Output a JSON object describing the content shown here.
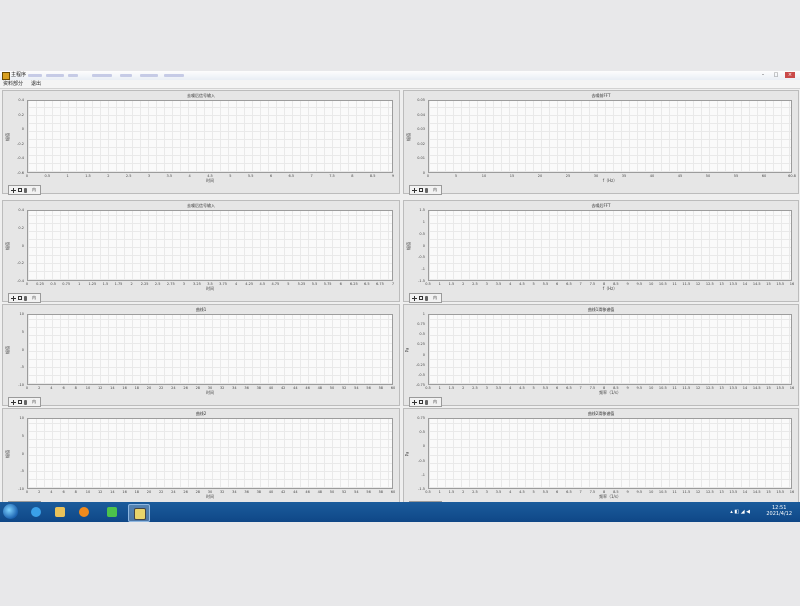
{
  "window": {
    "title": "主程序",
    "min": "–",
    "max": "□",
    "close": "×"
  },
  "menu": [
    "资料部分",
    "退出"
  ],
  "panels": [
    {
      "title": "去噪后信号输入",
      "ylabel": "幅值",
      "xlabel": "时间",
      "yticks": [
        "0.4",
        "0.2",
        "0",
        "-0.2",
        "-0.4",
        "-0.6"
      ],
      "xticks": [
        "0",
        "0.5",
        "1",
        "1.5",
        "2",
        "2.5",
        "3",
        "3.5",
        "4",
        "4.5",
        "5",
        "5.5",
        "6",
        "6.5",
        "7",
        "7.5",
        "8",
        "8.5",
        "9"
      ]
    },
    {
      "title": "去噪前FFT",
      "ylabel": "幅值",
      "xlabel": "f（Hz）",
      "yticks": [
        "0.05",
        "0.04",
        "0.03",
        "0.02",
        "0.01",
        "0"
      ],
      "xticks": [
        "0",
        "5",
        "10",
        "15",
        "20",
        "25",
        "30",
        "35",
        "40",
        "45",
        "50",
        "55",
        "60",
        "60.8"
      ]
    },
    {
      "title": "去噪后信号输入",
      "ylabel": "幅值",
      "xlabel": "时间",
      "yticks": [
        "0.4",
        "0.2",
        "0",
        "-0.2",
        "-0.4"
      ],
      "xticks": [
        "0",
        "0.25",
        "0.5",
        "0.75",
        "1",
        "1.25",
        "1.5",
        "1.75",
        "2",
        "2.25",
        "2.5",
        "2.75",
        "3",
        "3.25",
        "3.5",
        "3.75",
        "4",
        "4.25",
        "4.5",
        "4.75",
        "5",
        "5.25",
        "5.5",
        "5.75",
        "6",
        "6.25",
        "6.5",
        "6.75",
        "7"
      ]
    },
    {
      "title": "去噪后FFT",
      "ylabel": "幅值",
      "xlabel": "f（Hz）",
      "yticks": [
        "1.5",
        "1",
        "0.5",
        "0",
        "-0.5",
        "-1",
        "-1.5"
      ],
      "xticks": [
        "0.5",
        "1",
        "1.5",
        "2",
        "2.5",
        "3",
        "3.5",
        "4",
        "4.5",
        "5",
        "5.5",
        "6",
        "6.5",
        "7",
        "7.5",
        "8",
        "8.5",
        "9",
        "9.5",
        "10",
        "10.5",
        "11",
        "11.5",
        "12",
        "12.5",
        "13",
        "13.5",
        "14",
        "14.5",
        "15",
        "15.5",
        "16"
      ]
    },
    {
      "title": "曲线1",
      "ylabel": "幅值",
      "xlabel": "时间",
      "yticks": [
        "10",
        "5",
        "0",
        "-5",
        "-10"
      ],
      "xticks": [
        "0",
        "2",
        "4",
        "6",
        "8",
        "10",
        "12",
        "14",
        "16",
        "18",
        "20",
        "22",
        "24",
        "26",
        "28",
        "30",
        "32",
        "34",
        "36",
        "38",
        "40",
        "42",
        "44",
        "46",
        "48",
        "50",
        "52",
        "54",
        "56",
        "58",
        "60"
      ]
    },
    {
      "title": "曲线1滑移谱值",
      "ylabel": "Pa",
      "xlabel": "频率（1/s）",
      "yticks": [
        "1",
        "0.75",
        "0.5",
        "0.25",
        "0",
        "-0.25",
        "-0.5",
        "-0.75"
      ],
      "xticks": [
        "0.5",
        "1",
        "1.5",
        "2",
        "2.5",
        "3",
        "3.5",
        "4",
        "4.5",
        "5",
        "5.5",
        "6",
        "6.5",
        "7",
        "7.5",
        "8",
        "8.5",
        "9",
        "9.5",
        "10",
        "10.5",
        "11",
        "11.5",
        "12",
        "12.5",
        "13",
        "13.5",
        "14",
        "14.5",
        "15",
        "15.5",
        "16"
      ]
    },
    {
      "title": "曲线2",
      "ylabel": "幅值",
      "xlabel": "时间",
      "yticks": [
        "10",
        "5",
        "0",
        "-5",
        "-10"
      ],
      "xticks": [
        "0",
        "2",
        "4",
        "6",
        "8",
        "10",
        "12",
        "14",
        "16",
        "18",
        "20",
        "22",
        "24",
        "26",
        "28",
        "30",
        "32",
        "34",
        "36",
        "38",
        "40",
        "42",
        "44",
        "46",
        "48",
        "50",
        "52",
        "54",
        "56",
        "58",
        "60"
      ]
    },
    {
      "title": "曲线2滑移谱值",
      "ylabel": "Pa",
      "xlabel": "频率（1/s）",
      "yticks": [
        "0.75",
        "0.5",
        "0",
        "-0.5",
        "-1",
        "-1.5"
      ],
      "xticks": [
        "0.5",
        "1",
        "1.5",
        "2",
        "2.5",
        "3",
        "3.5",
        "4",
        "4.5",
        "5",
        "5.5",
        "6",
        "6.5",
        "7",
        "7.5",
        "8",
        "8.5",
        "9",
        "9.5",
        "10",
        "10.5",
        "11",
        "11.5",
        "12",
        "12.5",
        "13",
        "13.5",
        "14",
        "14.5",
        "15",
        "15.5",
        "16"
      ]
    }
  ],
  "tools_label": "内",
  "taskbar": {
    "time": "12:51",
    "date": "2021/4/12",
    "icons": [
      "ie-icon",
      "folder-icon",
      "media-player-icon",
      "wechat-icon",
      "labview-icon"
    ]
  }
}
